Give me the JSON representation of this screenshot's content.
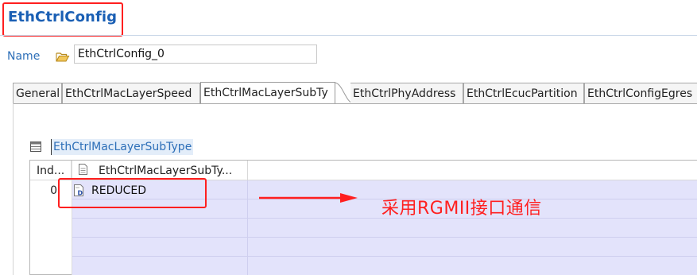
{
  "editor": {
    "title": "EthCtrlConfig",
    "name_label": "Name",
    "name_value": "EthCtrlConfig_0"
  },
  "tabs": [
    {
      "label": "General",
      "active": false
    },
    {
      "label": "EthCtrlMacLayerSpeed",
      "active": false
    },
    {
      "label": "EthCtrlMacLayerSubTy",
      "active": true
    },
    {
      "label": "EthCtrlPhyAddress",
      "active": false
    },
    {
      "label": "EthCtrlEcucPartition",
      "active": false
    },
    {
      "label": "EthCtrlConfigEgres",
      "active": false
    }
  ],
  "section": {
    "title": "EthCtrlMacLayerSubType",
    "icon": "table-icon"
  },
  "table": {
    "columns": [
      "Ind...",
      "EthCtrlMacLayerSubTy..."
    ],
    "rows": [
      {
        "index": "0",
        "value": "REDUCED",
        "icon": "enum-value-icon"
      }
    ]
  },
  "annotation": {
    "text": "采用RGMII接口通信",
    "color": "#ff2020"
  },
  "colors": {
    "title_blue": "#1a5fb4",
    "highlight_red": "#ff1f1f",
    "row_fill": "#e3e3fb"
  }
}
